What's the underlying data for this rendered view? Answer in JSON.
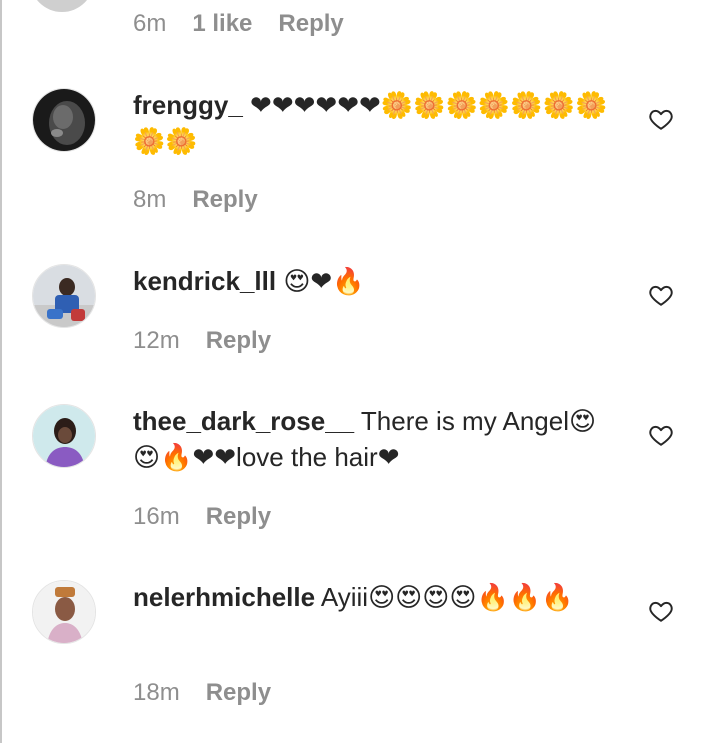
{
  "top_meta": {
    "time": "6m",
    "likes": "1 like",
    "reply": "Reply"
  },
  "comments": [
    {
      "username": "frenggy_",
      "text": "❤❤❤❤❤❤🌼🌼🌼🌼🌼🌼🌼🌼🌼",
      "time": "8m",
      "reply": "Reply"
    },
    {
      "username": "kendrick_lll",
      "text": "😍❤🔥",
      "time": "12m",
      "reply": "Reply"
    },
    {
      "username": "thee_dark_rose__",
      "text": "There is my Angel😍😍🔥❤❤love the hair❤",
      "time": "16m",
      "reply": "Reply"
    },
    {
      "username": "nelerhmichelle",
      "text": "Ayiii😍😍😍😍🔥🔥🔥",
      "time": "18m",
      "reply": "Reply"
    }
  ],
  "icons": {
    "like": "heart-outline-icon"
  },
  "colors": {
    "meta": "#8e8e8e",
    "text": "#262626",
    "heart": "#e0142c"
  }
}
